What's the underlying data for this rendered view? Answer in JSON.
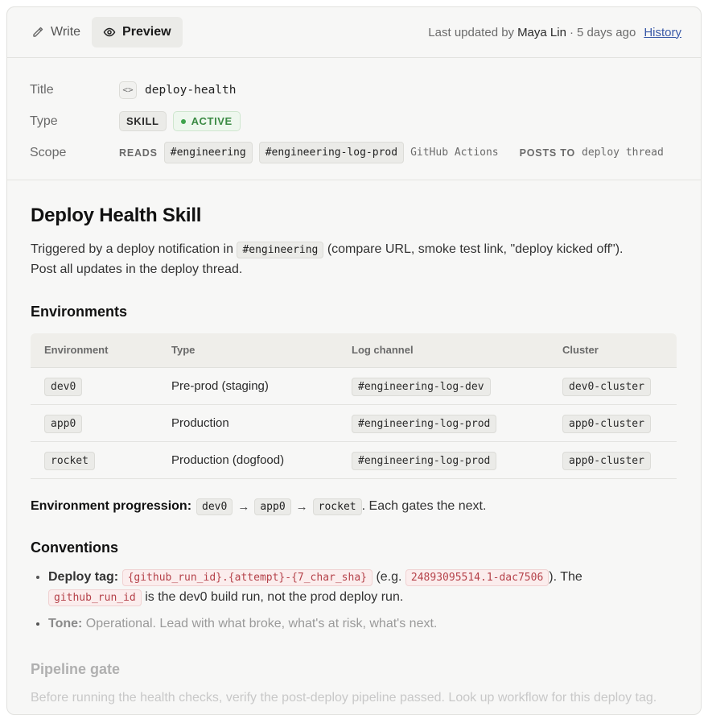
{
  "header": {
    "tab_write": "Write",
    "tab_preview": "Preview",
    "last_updated_prefix": "Last updated by",
    "user": "Maya Lin",
    "separator": "·",
    "time_ago": "5 days ago",
    "history": "History"
  },
  "meta": {
    "title_label": "Title",
    "title_value": "deploy-health",
    "type_label": "Type",
    "type_badge": "SKILL",
    "status_badge": "ACTIVE",
    "scope_label": "Scope",
    "reads_key": "READS",
    "reads_channels": [
      "#engineering",
      "#engineering-log-prod"
    ],
    "reads_plain": "GitHub Actions",
    "posts_key": "POSTS TO",
    "posts_plain": "deploy thread"
  },
  "content": {
    "heading": "Deploy Health Skill",
    "intro_pre": "Triggered by a deploy notification in ",
    "intro_code": "#engineering",
    "intro_post": " (compare URL, smoke test link, \"deploy kicked off\").",
    "intro_line2": "Post all updates in the deploy thread.",
    "env_heading": "Environments",
    "env_table": {
      "headers": [
        "Environment",
        "Type",
        "Log channel",
        "Cluster"
      ],
      "rows": [
        [
          "dev0",
          "Pre-prod (staging)",
          "#engineering-log-dev",
          "dev0-cluster"
        ],
        [
          "app0",
          "Production",
          "#engineering-log-prod",
          "app0-cluster"
        ],
        [
          "rocket",
          "Production (dogfood)",
          "#engineering-log-prod",
          "app0-cluster"
        ]
      ]
    },
    "progression_label": "Environment progression:",
    "progression_steps": [
      "dev0",
      "app0",
      "rocket"
    ],
    "progression_arrow": "→",
    "progression_tail": ". Each gates the next.",
    "conventions_heading": "Conventions",
    "deploy_tag_label": "Deploy tag:",
    "deploy_tag_code": "{github_run_id}.{attempt}-{7_char_sha}",
    "deploy_tag_eg_pre": " (e.g. ",
    "deploy_tag_example": "24893095514.1-dac7506",
    "deploy_tag_eg_post": "). The",
    "deploy_tag_code2": "github_run_id",
    "deploy_tag_tail": " is the dev0 build run, not the prod deploy run.",
    "tone_label": "Tone:",
    "tone_text": " Operational. Lead with what broke, what's at risk, what's next.",
    "pipeline_heading": "Pipeline gate",
    "pipeline_text": "Before running the health checks, verify the post-deploy pipeline passed. Look up workflow for this deploy tag."
  }
}
